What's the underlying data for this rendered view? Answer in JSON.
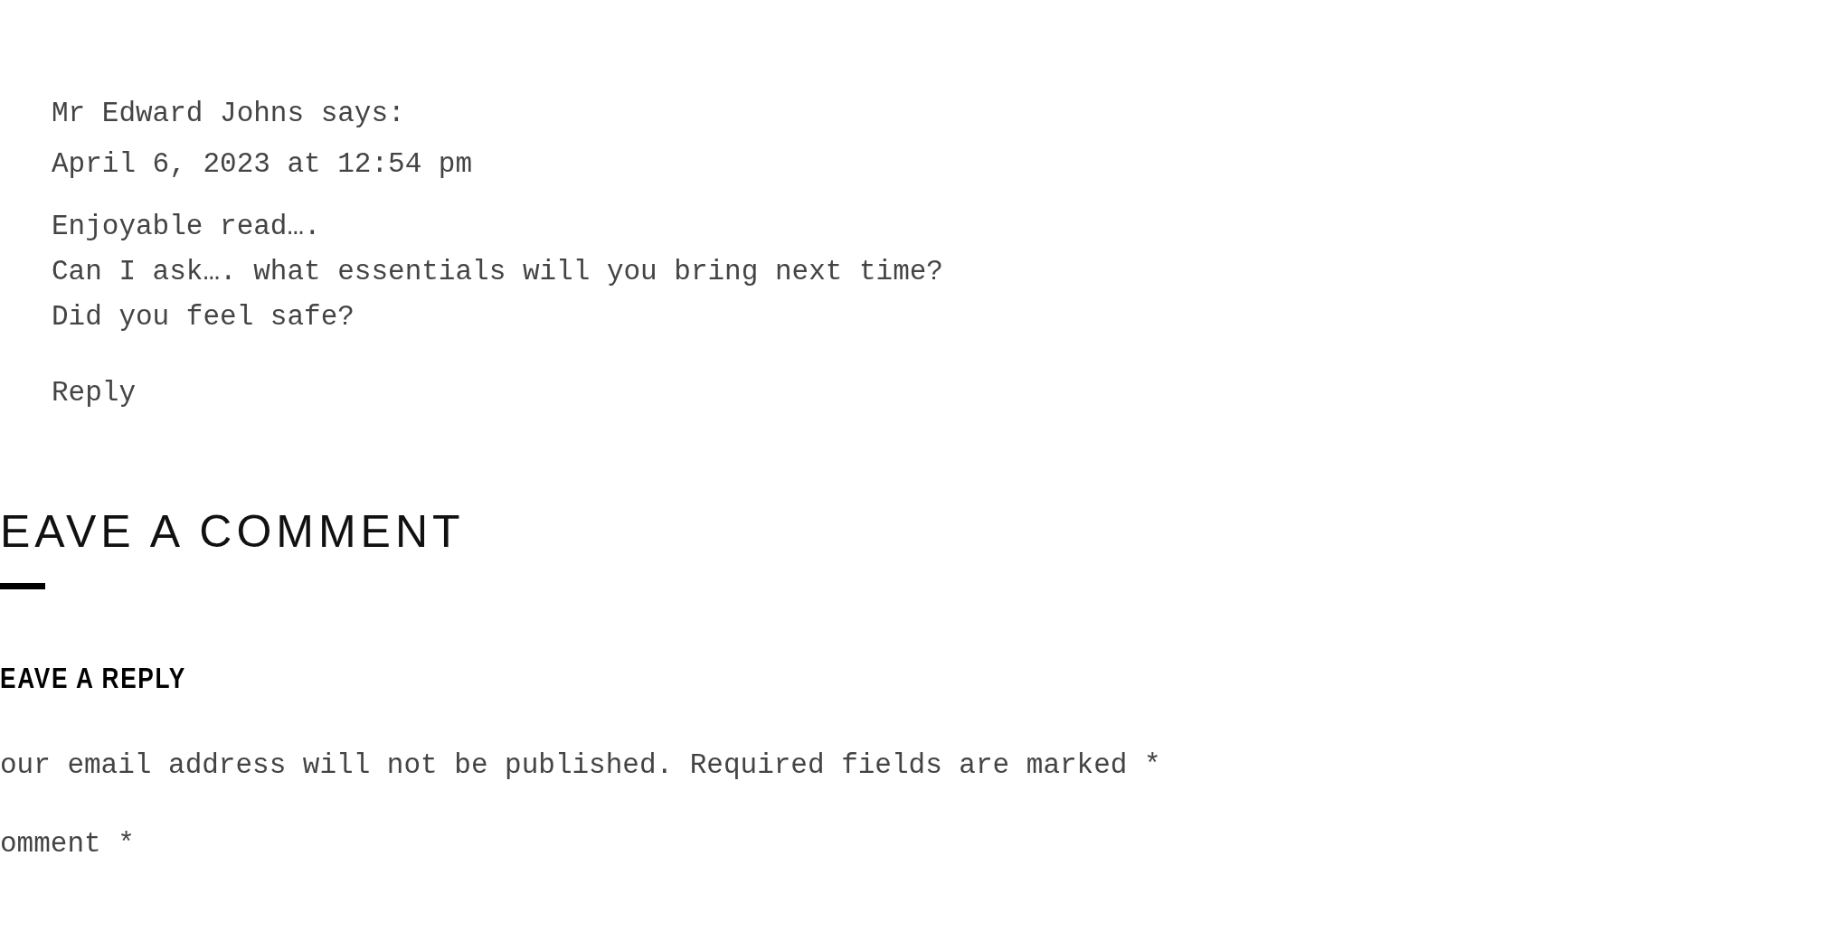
{
  "comment": {
    "author": "Mr Edward Johns says:",
    "date": "April 6, 2023 at 12:54 pm",
    "lines": [
      "Enjoyable read….",
      "Can I ask…. what essentials will you bring next time?",
      "Did you feel safe?"
    ],
    "reply_link": "Reply"
  },
  "section_title": "EAVE A COMMENT",
  "form": {
    "title": "EAVE A REPLY",
    "notice": "our email address will not be published. Required fields are marked *",
    "comment_label": "omment *"
  }
}
